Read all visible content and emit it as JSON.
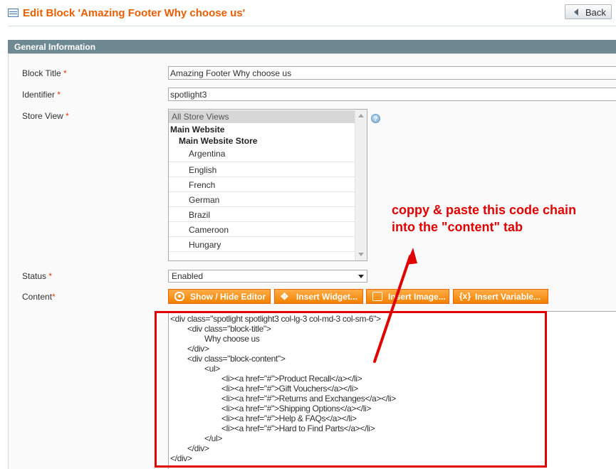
{
  "header": {
    "title": "Edit Block 'Amazing Footer Why choose us'",
    "back_label": "Back",
    "title_icon": "grid-icon"
  },
  "section": {
    "title": "General Information"
  },
  "form": {
    "block_title": {
      "label": "Block Title",
      "required": "*",
      "value": "Amazing Footer Why choose us"
    },
    "identifier": {
      "label": "Identifier",
      "required": "*",
      "value": "spotlight3"
    },
    "store_view": {
      "label": "Store View",
      "required": "*",
      "selected": "All Store Views",
      "website": "Main Website",
      "store": "Main Website Store",
      "options": [
        "Argentina",
        "English",
        "French",
        "German",
        "Brazil",
        "Cameroon",
        "Hungary"
      ]
    },
    "status": {
      "label": "Status",
      "required": "*",
      "value": "Enabled"
    },
    "content": {
      "label": "Content",
      "required": "*"
    }
  },
  "editor_buttons": {
    "show_hide": "Show / Hide Editor",
    "insert_widget": "Insert Widget...",
    "insert_image": "Insert Image...",
    "insert_variable": "Insert Variable..."
  },
  "code_lines": [
    "<div class=\"spotlight spotlight3 col-lg-3 col-md-3 col-sm-6\">",
    "<div class=\"block-title\">",
    "Why choose us",
    "</div>",
    "<div class=\"block-content\">",
    "<ul>",
    "<li><a href=\"#\">Product Recall</a></li>",
    "<li><a href=\"#\">Gift Vouchers</a></li>",
    "<li><a href=\"#\">Returns and Exchanges</a></li>",
    "<li><a href=\"#\">Shipping Options</a></li>",
    "<li><a href=\"#\">Help & FAQs</a></li>",
    "<li><a href=\"#\">Hard to Find Parts</a></li>",
    "</ul>",
    "</div>",
    "</div>"
  ],
  "annotation": {
    "line1": "coppy & paste this code chain",
    "line2": "into the \"content\" tab",
    "color": "#e10000"
  },
  "colors": {
    "title": "#eb5e00",
    "section_bar": "#6f8992",
    "button": "#f18200",
    "required": "#eb340a"
  }
}
